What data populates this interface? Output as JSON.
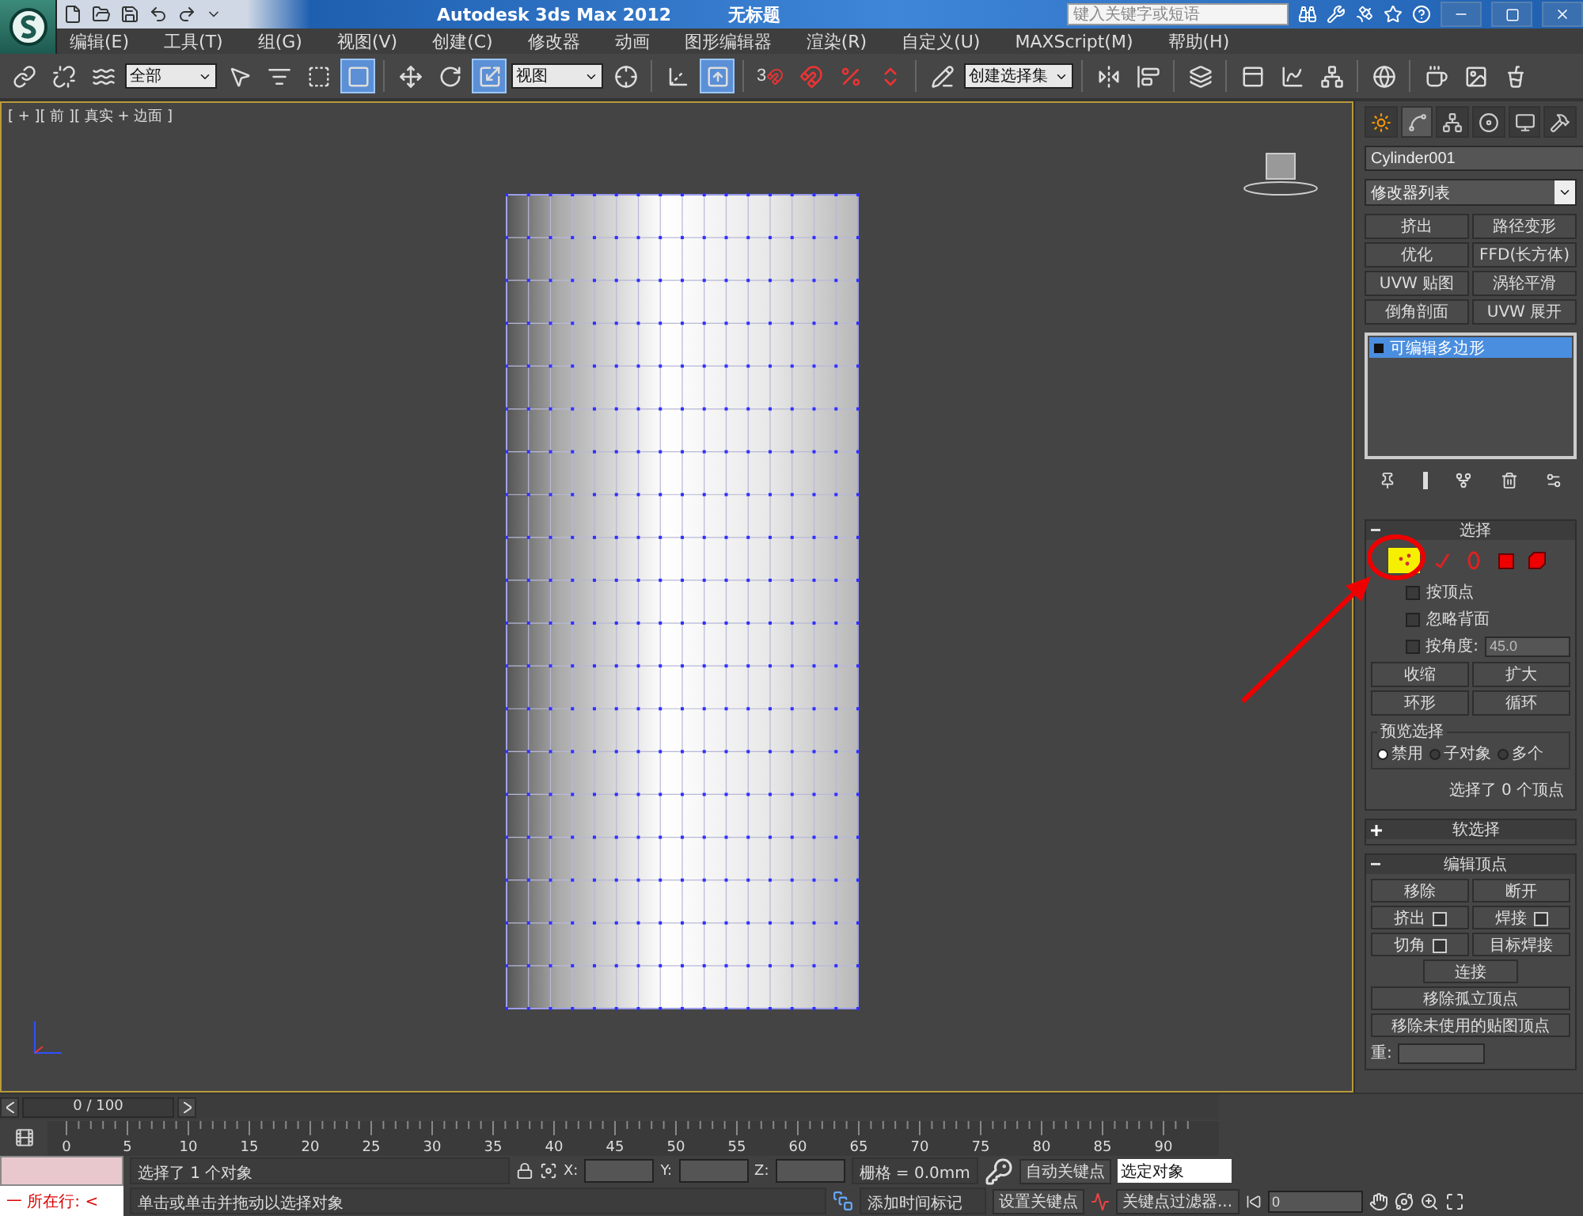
{
  "title_bar": {
    "title": "Autodesk 3ds Max  2012",
    "document": "无标题",
    "search": {
      "placeholder": "键入关键字或短语"
    }
  },
  "menu": [
    "编辑(E)",
    "工具(T)",
    "组(G)",
    "视图(V)",
    "创建(C)",
    "修改器",
    "动画",
    "图形编辑器",
    "渲染(R)",
    "自定义(U)",
    "MAXScript(M)",
    "帮助(H)"
  ],
  "toolbar": [
    {
      "kind": "link",
      "selected": false
    },
    {
      "kind": "unlink",
      "selected": false
    },
    {
      "kind": "bind",
      "selected": false
    },
    {
      "kind": "dropdown",
      "value": "全部"
    },
    {
      "kind": "select",
      "selected": false
    },
    {
      "kind": "select-name",
      "selected": false
    },
    {
      "kind": "region",
      "selected": false
    },
    {
      "kind": "crossing",
      "selected": true
    },
    {
      "kind": "sep"
    },
    {
      "kind": "move",
      "selected": false
    },
    {
      "kind": "rotate",
      "selected": false
    },
    {
      "kind": "scale",
      "selected": true
    },
    {
      "kind": "dropdown",
      "value": "视图"
    },
    {
      "kind": "pivot",
      "selected": false
    },
    {
      "kind": "sep"
    },
    {
      "kind": "manipulate",
      "selected": false
    },
    {
      "kind": "keyboard",
      "selected": true
    },
    {
      "kind": "sep"
    },
    {
      "kind": "snap",
      "label": "3",
      "selected": false
    },
    {
      "kind": "angle-snap",
      "selected": false
    },
    {
      "kind": "percent-snap",
      "selected": false
    },
    {
      "kind": "spinner-snap",
      "selected": false
    },
    {
      "kind": "sep"
    },
    {
      "kind": "named-edit",
      "selected": false
    },
    {
      "kind": "dropdown",
      "value": "创建选择集"
    },
    {
      "kind": "sep"
    },
    {
      "kind": "mirror",
      "selected": false
    },
    {
      "kind": "align",
      "selected": false
    },
    {
      "kind": "sep"
    },
    {
      "kind": "layers",
      "selected": false
    },
    {
      "kind": "sep"
    },
    {
      "kind": "ribbon",
      "selected": false
    },
    {
      "kind": "curve-editor",
      "selected": false
    },
    {
      "kind": "schematic",
      "selected": false
    },
    {
      "kind": "sep"
    },
    {
      "kind": "material",
      "selected": false
    },
    {
      "kind": "sep"
    },
    {
      "kind": "render-setup",
      "selected": false
    },
    {
      "kind": "render-frame",
      "selected": false
    },
    {
      "kind": "render",
      "selected": false
    }
  ],
  "viewport": {
    "label": "[ + ][ 前 ][ 真实 + 边面 ]"
  },
  "command_panel": {
    "tabs": [
      {
        "kind": "create",
        "selected": false
      },
      {
        "kind": "modify",
        "selected": true
      },
      {
        "kind": "hierarchy",
        "selected": false
      },
      {
        "kind": "motion",
        "selected": false
      },
      {
        "kind": "display",
        "selected": false
      },
      {
        "kind": "utilities",
        "selected": false
      }
    ],
    "object_name": "Cylinder001",
    "modifier_list": "修改器列表",
    "modifier_buttons": [
      "挤出",
      "路径变形",
      "优化",
      "FFD(长方体)",
      "UVW 贴图",
      "涡轮平滑",
      "倒角剖面",
      "UVW 展开"
    ],
    "stack": [
      {
        "label": "可编辑多边形",
        "selected": true
      }
    ],
    "selection": {
      "title": "选择",
      "expanded": true,
      "levels": [
        {
          "kind": "vertex",
          "selected": true
        },
        {
          "kind": "edge",
          "selected": false
        },
        {
          "kind": "border",
          "selected": false
        },
        {
          "kind": "polygon",
          "selected": false
        },
        {
          "kind": "element",
          "selected": false
        }
      ],
      "checks": [
        {
          "label": "按顶点",
          "checked": false
        },
        {
          "label": "忽略背面",
          "checked": false
        },
        {
          "label": "按角度:",
          "checked": false
        }
      ],
      "angle": "45.0",
      "grow_buttons": [
        "收缩",
        "扩大"
      ],
      "loop_buttons": [
        "环形",
        "循环"
      ],
      "preview": {
        "title": "预览选择",
        "options": [
          {
            "label": "禁用",
            "selected": true
          },
          {
            "label": "子对象",
            "selected": false
          },
          {
            "label": "多个",
            "selected": false
          }
        ]
      },
      "status": "选择了 0 个顶点"
    },
    "soft_selection": {
      "title": "软选择",
      "expanded": false
    },
    "edit_vertices": {
      "title": "编辑顶点",
      "expanded": true,
      "buttons": [
        {
          "label": "移除",
          "kind": "half"
        },
        {
          "label": "断开",
          "kind": "half"
        },
        {
          "label": "挤出",
          "kind": "settings"
        },
        {
          "label": "焊接",
          "kind": "settings"
        },
        {
          "label": "切角",
          "kind": "settings"
        },
        {
          "label": "目标焊接",
          "kind": "half"
        },
        {
          "label": "连接",
          "kind": "center"
        },
        {
          "label": "移除孤立顶点",
          "kind": "wide"
        },
        {
          "label": "移除未使用的贴图顶点",
          "kind": "wide"
        }
      ],
      "weight_label": "重:"
    }
  },
  "timeline": {
    "slider": "0 / 100",
    "ticks": [
      "0",
      "5",
      "10",
      "15",
      "20",
      "25",
      "30",
      "35",
      "40",
      "45",
      "50",
      "55",
      "60",
      "65",
      "70",
      "75",
      "80",
      "85",
      "90"
    ]
  },
  "status_bar": {
    "listener": "一  所在行:  <",
    "message": "选择了 1 个对象",
    "prompt": "单击或单击并拖动以选择对象",
    "coords": [
      "X:",
      "Y:",
      "Z:"
    ],
    "grid": "栅格 = 0.0mm",
    "time_tag": "添加时间标记",
    "auto_key": "自动关键点",
    "set_key": "设置关键点",
    "key_mode": "选定对象",
    "key_filters": "关键点过滤器...",
    "frame": "0"
  }
}
